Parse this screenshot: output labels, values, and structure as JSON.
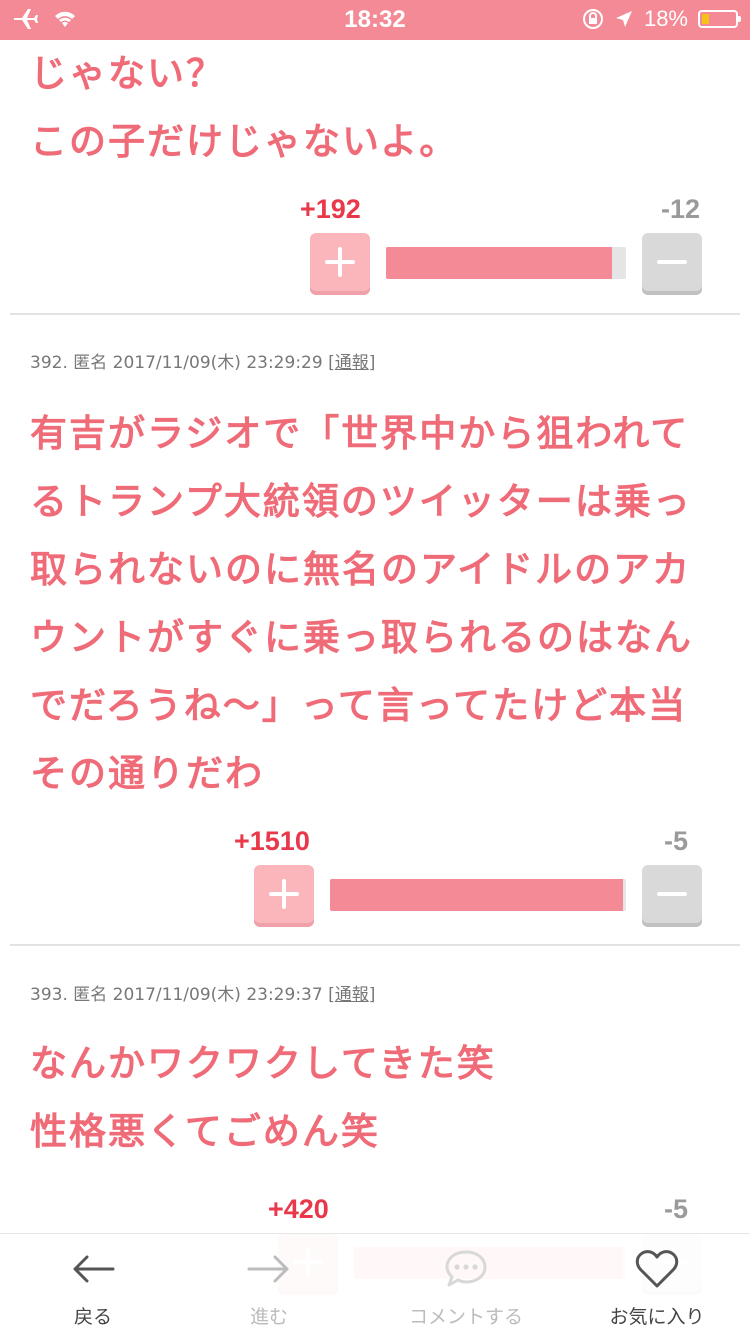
{
  "status_bar": {
    "time": "18:32",
    "battery_percent": "18%"
  },
  "comments": [
    {
      "text_tail": "じゃない？\nこの子だけじゃないよ。",
      "plus": "+192",
      "minus": "-12",
      "ratio": 0.94
    },
    {
      "number": "392.",
      "author": "匿名",
      "datetime": "2017/11/09(木) 23:29:29",
      "report_label": "通報",
      "text": "有吉がラジオで「世界中から狙われて\nるトランプ大統領のツイッターは乗っ\n取られないのに無名のアイドルのアカ\nウントがすぐに乗っ取られるのはなん\nでだろうね〜」って言ってたけど本当\nその通りだわ",
      "plus": "+1510",
      "minus": "-5",
      "ratio": 0.99
    },
    {
      "number": "393.",
      "author": "匿名",
      "datetime": "2017/11/09(木) 23:29:37",
      "report_label": "通報",
      "text": "なんかワクワクしてきた笑\n性格悪くてごめん笑",
      "plus": "+420",
      "minus": "-5",
      "ratio": 0.99
    }
  ],
  "bottom_nav": {
    "back": "戻る",
    "forward": "進む",
    "comment": "コメントする",
    "favorite": "お気に入り"
  },
  "colors": {
    "accent": "#f48a95",
    "text_pink": "#ef6b78",
    "plus_red": "#e83849",
    "minus_gray": "#9a9a9a"
  }
}
